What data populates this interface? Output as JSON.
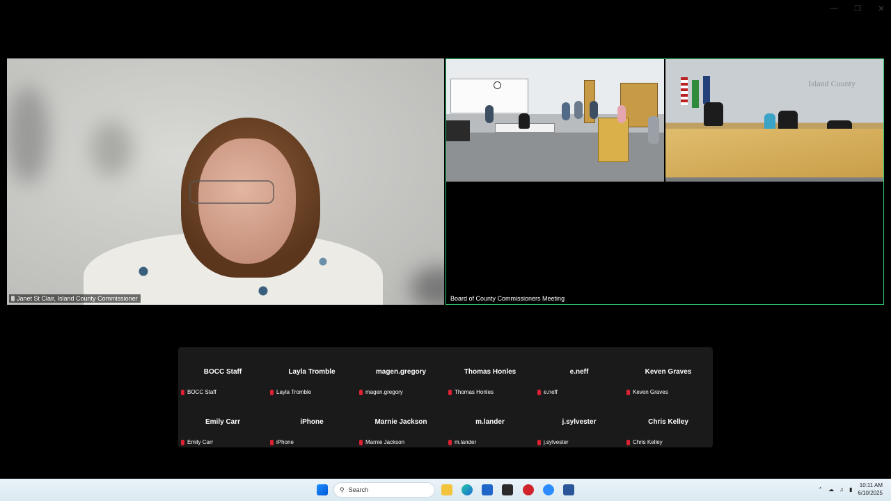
{
  "speaker": {
    "name": "Janet St Clair, Island County Commissioner"
  },
  "room": {
    "label": "Board of County Commissioners Meeting",
    "logo_text": "Island County"
  },
  "participants": [
    {
      "name": "BOCC Staff",
      "label": "BOCC Staff"
    },
    {
      "name": "Layla Tromble",
      "label": "Layla Tromble"
    },
    {
      "name": "magen.gregory",
      "label": "magen.gregory"
    },
    {
      "name": "Thomas Honles",
      "label": "Thomas Honles"
    },
    {
      "name": "e.neff",
      "label": "e.neff"
    },
    {
      "name": "Keven Graves",
      "label": "Keven Graves"
    },
    {
      "name": "Emily Carr",
      "label": "Emily Carr"
    },
    {
      "name": "iPhone",
      "label": "iPhone"
    },
    {
      "name": "Marnie Jackson",
      "label": "Marnie Jackson"
    },
    {
      "name": "m.lander",
      "label": "m.lander"
    },
    {
      "name": "j.sylvester",
      "label": "j.sylvester"
    },
    {
      "name": "Chris Kelley",
      "label": "Chris Kelley"
    }
  ],
  "taskbar": {
    "search_placeholder": "Search",
    "time": "10:11 AM",
    "date": "6/10/2025"
  },
  "colors": {
    "active_speaker_border": "#2ecc71",
    "muted": "#dd2233"
  }
}
